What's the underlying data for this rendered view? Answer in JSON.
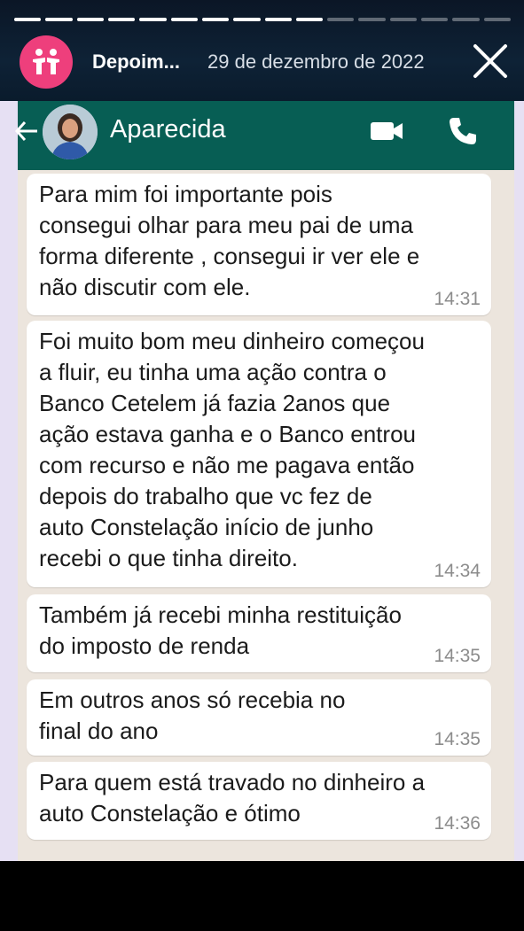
{
  "story": {
    "account_name": "Depoim...",
    "date": "29 de dezembro de 2022",
    "progress_segments": 16,
    "progress_done": 10
  },
  "chat": {
    "contact_name": "Aparecida",
    "messages": [
      {
        "text": "Para mim foi importante pois\nconsegui olhar para meu pai de uma\nforma diferente , consegui ir ver ele    e\nnão discutir com ele.",
        "time": "14:31"
      },
      {
        "text": "Foi muito bom meu dinheiro começou\na fluir, eu tinha uma ação contra o\nBanco Cetelem já fazia 2anos que\nação estava ganha e o Banco entrou\ncom recurso e não me pagava então\ndepois    do trabalho que vc fez de\nauto Constelação início de junho\nrecebi o que tinha direito.",
        "time": "14:34"
      },
      {
        "text": "Também já recebi minha restituição\ndo imposto de renda",
        "time": "14:35"
      },
      {
        "text": "Em outros anos só recebia no\nfinal do ano",
        "time": "14:35"
      },
      {
        "text": "Para quem está travado no dinheiro a\nauto Constelação e ótimo",
        "time": "14:36"
      }
    ]
  },
  "colors": {
    "whatsapp_header": "#075e54",
    "story_avatar": "#ee3f7c",
    "chat_background": "#ece5dd"
  }
}
